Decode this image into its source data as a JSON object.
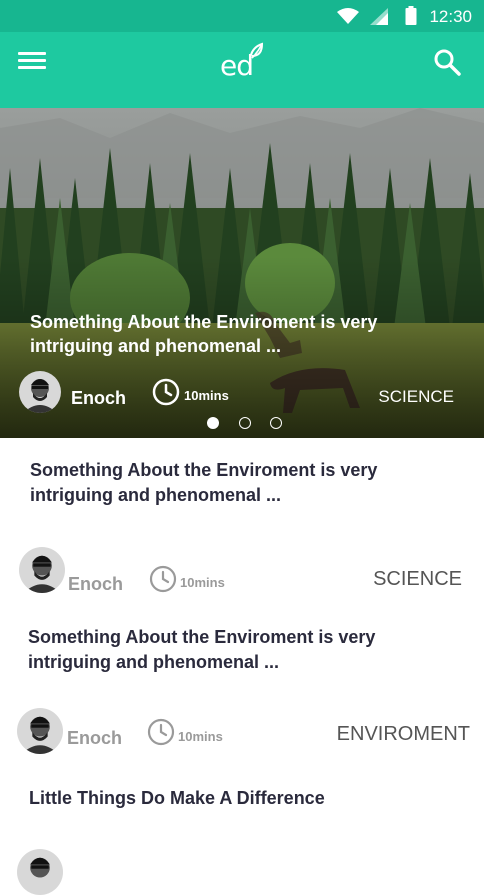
{
  "status_bar": {
    "time": "12:30"
  },
  "app_bar": {
    "logo_text": "ed"
  },
  "hero": {
    "title": "Something About the Enviroment is very intriguing and phenomenal ...",
    "author": "Enoch",
    "read_time": "10mins",
    "category": "SCIENCE",
    "carousel": {
      "count": 3,
      "active_index": 0
    }
  },
  "articles": [
    {
      "title": "Something About the Enviroment is very intriguing and phenomenal ...",
      "author": "Enoch",
      "read_time": "10mins",
      "category": "SCIENCE"
    },
    {
      "title": "Something About the Enviroment is very intriguing and phenomenal ...",
      "author": "Enoch",
      "read_time": "10mins",
      "category": "ENVIROMENT"
    },
    {
      "title": "Little Things Do Make A Difference"
    }
  ],
  "colors": {
    "status_bar": "#17b690",
    "app_bar": "#1ec9a0"
  }
}
